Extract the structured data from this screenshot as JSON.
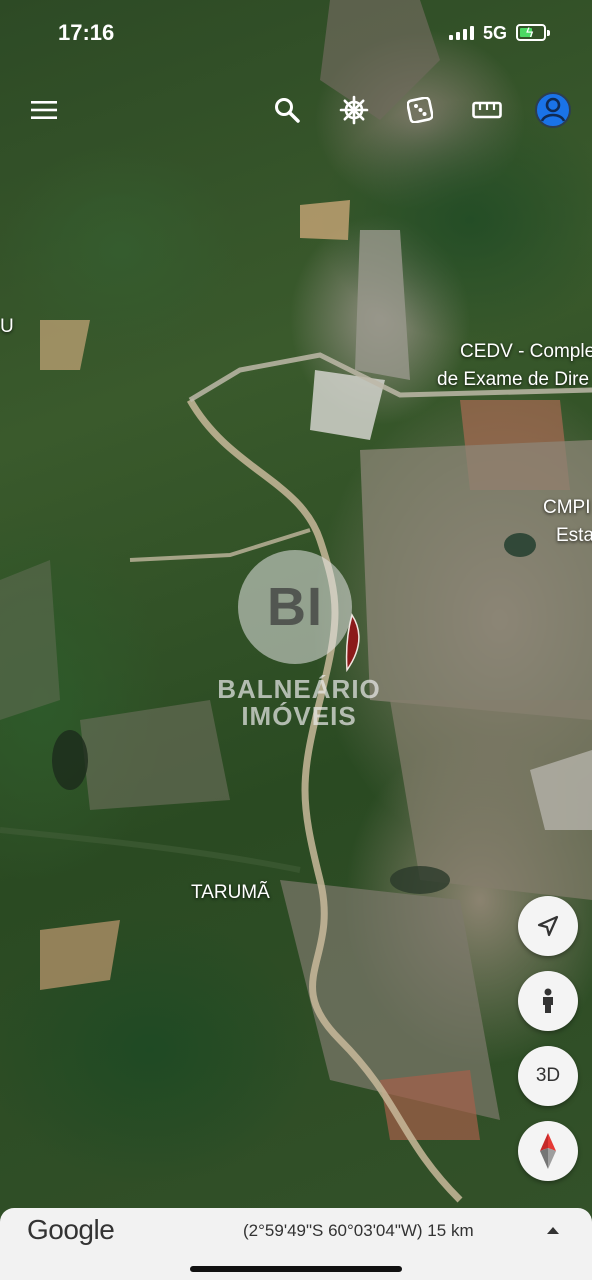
{
  "status_bar": {
    "time": "17:16",
    "network": "5G",
    "battery_color": "#4cd964"
  },
  "toolbar": {
    "menu_icon": "hamburger-menu-icon",
    "search_icon": "search-icon",
    "voyager_icon": "ship-wheel-icon",
    "feeling_lucky_icon": "dice-icon",
    "measure_icon": "ruler-icon",
    "account_icon": "account-avatar-icon",
    "accent_color": "#1a73e8"
  },
  "map": {
    "labels": {
      "left_edge": "U",
      "cedv_line1": "CEDV - Comple",
      "cedv_line2": "de Exame de Dire",
      "cmp_line1": "CMPI",
      "cmp_line2": "Esta",
      "taruma": "TARUMÃ"
    },
    "watermark": {
      "monogram": "BI",
      "name_line1": "BALNEÁRIO",
      "name_line2": "IMÓVEIS"
    },
    "property_marker_color": "#8b1a1a"
  },
  "controls": {
    "location_icon": "navigation-arrow-icon",
    "pegman_icon": "pegman-icon",
    "view_3d_label": "3D",
    "compass_icon": "compass-icon"
  },
  "bottom_bar": {
    "logo": "Google",
    "coordinates": "(2°59'49\"S 60°03'04\"W) 15 km",
    "expand_icon": "chevron-up-icon"
  }
}
